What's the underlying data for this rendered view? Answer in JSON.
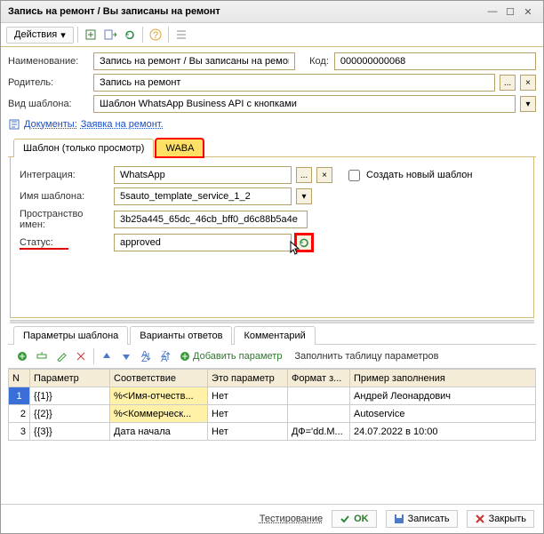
{
  "window": {
    "title": "Запись на ремонт / Вы записаны на ремонт"
  },
  "toolbar": {
    "actions_label": "Действия"
  },
  "form": {
    "name_label": "Наименование:",
    "name_value": "Запись на ремонт / Вы записаны на ремонт",
    "code_label": "Код:",
    "code_value": "000000000068",
    "parent_label": "Родитель:",
    "parent_value": "Запись на ремонт",
    "template_type_label": "Вид шаблона:",
    "template_type_value": "Шаблон WhatsApp Business API с кнопками",
    "documents_label": "Документы:",
    "documents_link": "Заявка на ремонт."
  },
  "tabs": {
    "view_only": "Шаблон (только просмотр)",
    "waba": "WABA"
  },
  "waba_panel": {
    "integration_label": "Интеграция:",
    "integration_value": "WhatsApp",
    "create_new_label": "Создать новый шаблон",
    "template_name_label": "Имя шаблона:",
    "template_name_value": "5sauto_template_service_1_2",
    "namespace_label": "Пространство имен:",
    "namespace_value": "3b25a445_65dc_46cb_bff0_d6c88b5a4e",
    "status_label": "Статус:",
    "status_value": "approved"
  },
  "subtabs": {
    "params": "Параметры шаблона",
    "answers": "Варианты ответов",
    "comment": "Комментарий"
  },
  "param_toolbar": {
    "add_param": "Добавить параметр",
    "fill_table": "Заполнить таблицу параметров"
  },
  "grid": {
    "headers": {
      "n": "N",
      "param": "Параметр",
      "match": "Соответствие",
      "is_param": "Это параметр",
      "format": "Формат з...",
      "example": "Пример заполнения"
    },
    "rows": [
      {
        "n": "1",
        "param": "{{1}}",
        "match": "%<Имя-отчеств...",
        "is_param": "Нет",
        "format": "",
        "example": "Андрей Леонардович"
      },
      {
        "n": "2",
        "param": "{{2}}",
        "match": "%<Коммерческ...",
        "is_param": "Нет",
        "format": "",
        "example": "Autoservice"
      },
      {
        "n": "3",
        "param": "{{3}}",
        "match": "Дата начала",
        "is_param": "Нет",
        "format": "ДФ='dd.M...",
        "example": "24.07.2022 в 10:00"
      }
    ]
  },
  "bottom": {
    "test": "Тестирование",
    "ok": "OK",
    "save": "Записать",
    "close": "Закрыть"
  }
}
